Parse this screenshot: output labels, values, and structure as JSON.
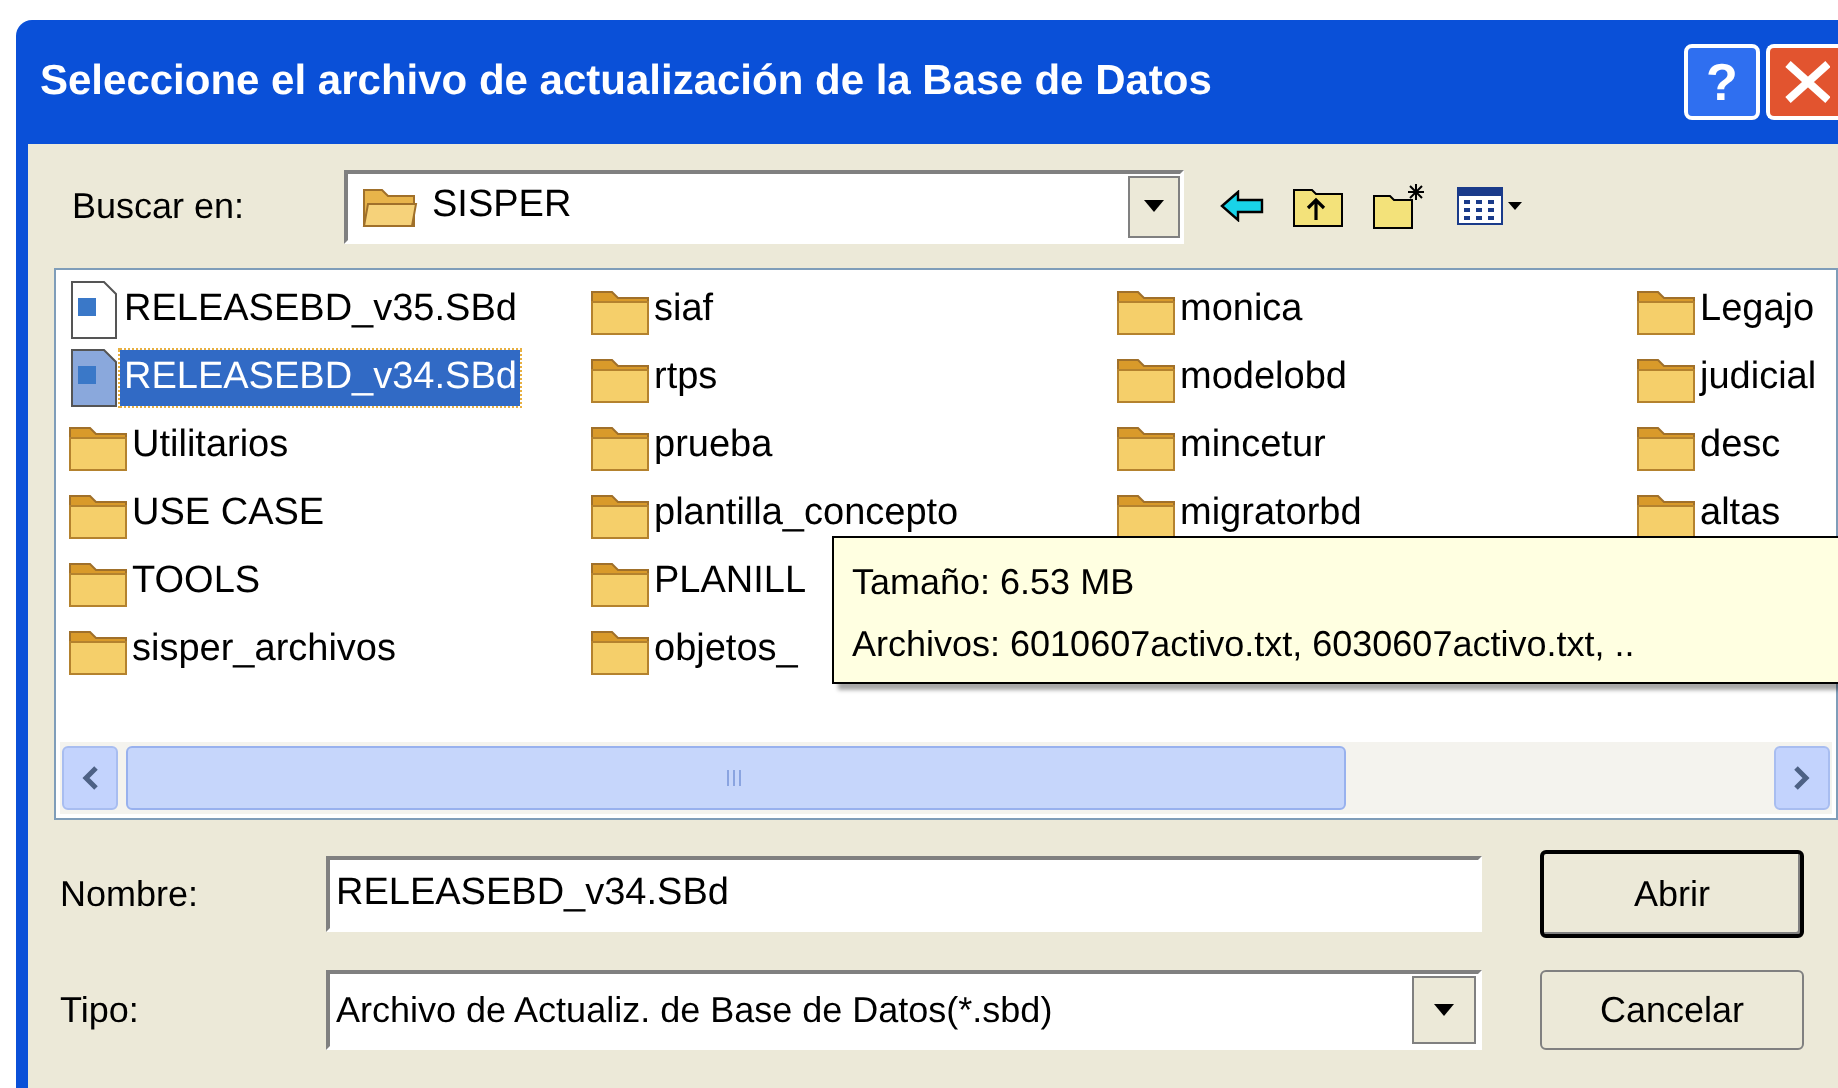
{
  "window": {
    "title": "Seleccione el archivo de actualización de la Base de Datos",
    "buttons": [
      {
        "kind": "help",
        "label": "?"
      },
      {
        "kind": "close"
      }
    ]
  },
  "look_in": {
    "label": "Buscar en:",
    "value": "SISPER"
  },
  "files": {
    "columns": [
      {
        "items": [
          {
            "name": "RELEASEBD_v35.SBd",
            "kind": "file",
            "selected": false
          },
          {
            "name": "RELEASEBD_v34.SBd",
            "kind": "file",
            "selected": true
          },
          {
            "name": "Utilitarios",
            "kind": "folder",
            "selected": false
          },
          {
            "name": "USE CASE",
            "kind": "folder",
            "selected": false
          },
          {
            "name": "TOOLS",
            "kind": "folder",
            "selected": false
          },
          {
            "name": "sisper_archivos",
            "kind": "folder",
            "selected": false
          }
        ]
      },
      {
        "items": [
          {
            "name": "siaf",
            "kind": "folder",
            "selected": false
          },
          {
            "name": "rtps",
            "kind": "folder",
            "selected": false
          },
          {
            "name": "prueba",
            "kind": "folder",
            "selected": false
          },
          {
            "name": "plantilla_concepto",
            "kind": "folder",
            "selected": false
          },
          {
            "name": "PLANILL",
            "kind": "folder",
            "selected": false
          },
          {
            "name": "objetos_",
            "kind": "folder",
            "selected": false
          }
        ]
      },
      {
        "items": [
          {
            "name": "monica",
            "kind": "folder",
            "selected": false
          },
          {
            "name": "modelobd",
            "kind": "folder",
            "selected": false
          },
          {
            "name": "mincetur",
            "kind": "folder",
            "selected": false
          },
          {
            "name": "migratorbd",
            "kind": "folder",
            "selected": false
          }
        ]
      },
      {
        "items": [
          {
            "name": "Legajo",
            "kind": "folder",
            "selected": false
          },
          {
            "name": "judicial",
            "kind": "folder",
            "selected": false
          },
          {
            "name": "desc",
            "kind": "folder",
            "selected": false
          },
          {
            "name": "altas",
            "kind": "folder",
            "selected": false
          }
        ]
      }
    ]
  },
  "tooltip": {
    "lines": [
      "Tamaño: 6.53 MB",
      "Archivos: 6010607activo.txt, 6030607activo.txt, .."
    ]
  },
  "file_name": {
    "label": "Nombre:",
    "value": "RELEASEBD_v34.SBd"
  },
  "file_type": {
    "label": "Tipo:",
    "value": "Archivo de Actualiz. de Base de Datos(*.sbd)"
  },
  "buttons": [
    {
      "label": "Abrir",
      "default": true
    },
    {
      "label": "Cancelar",
      "default": false
    }
  ]
}
